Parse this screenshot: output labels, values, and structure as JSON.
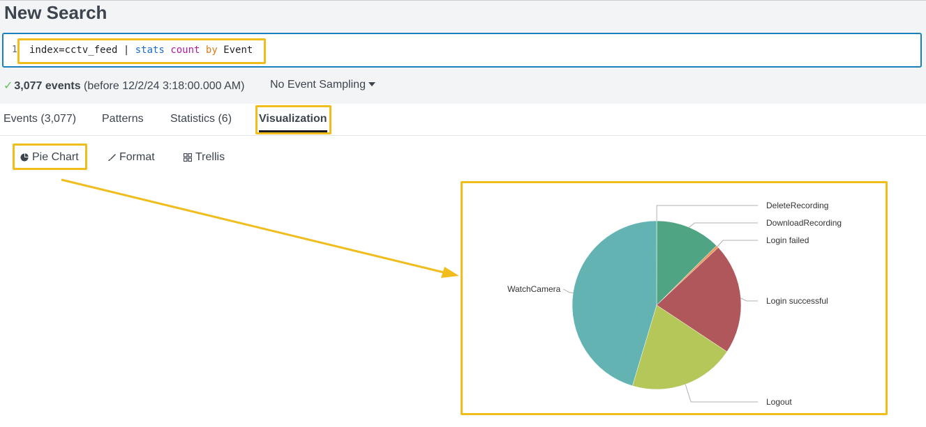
{
  "header": {
    "title": "New Search"
  },
  "search": {
    "line_number": "1",
    "query": {
      "part1": "index=cctv_feed | ",
      "kw1": "stats",
      "fn": "count",
      "kw2": "by",
      "field": "Event"
    }
  },
  "status": {
    "check": "✓",
    "events": "3,077 events",
    "before": "(before 12/2/24 3:18:00.000 AM)",
    "sampling": "No Event Sampling"
  },
  "tabs": [
    {
      "label": "Events (3,077)"
    },
    {
      "label": "Patterns"
    },
    {
      "label": "Statistics (6)"
    },
    {
      "label": "Visualization",
      "active": true
    }
  ],
  "viz_toolbar": {
    "chart_type": "Pie Chart",
    "format": "Format",
    "trellis": "Trellis"
  },
  "colors": {
    "highlight": "#f0bd1c",
    "search_border": "#1a7fbf",
    "kw_blue": "#1a6dc9",
    "kw_magenta": "#b0189a",
    "kw_orange": "#e07b1a"
  },
  "chart_data": {
    "type": "pie",
    "categories": [
      "DeleteRecording",
      "DownloadRecording",
      "Login failed",
      "Login successful",
      "Logout",
      "WatchCamera"
    ],
    "values": [
      1,
      385,
      15,
      655,
      625,
      1396
    ],
    "colors": [
      "#909090",
      "#4fa484",
      "#ec9960",
      "#af575a",
      "#b6c75a",
      "#62b3b2"
    ]
  }
}
